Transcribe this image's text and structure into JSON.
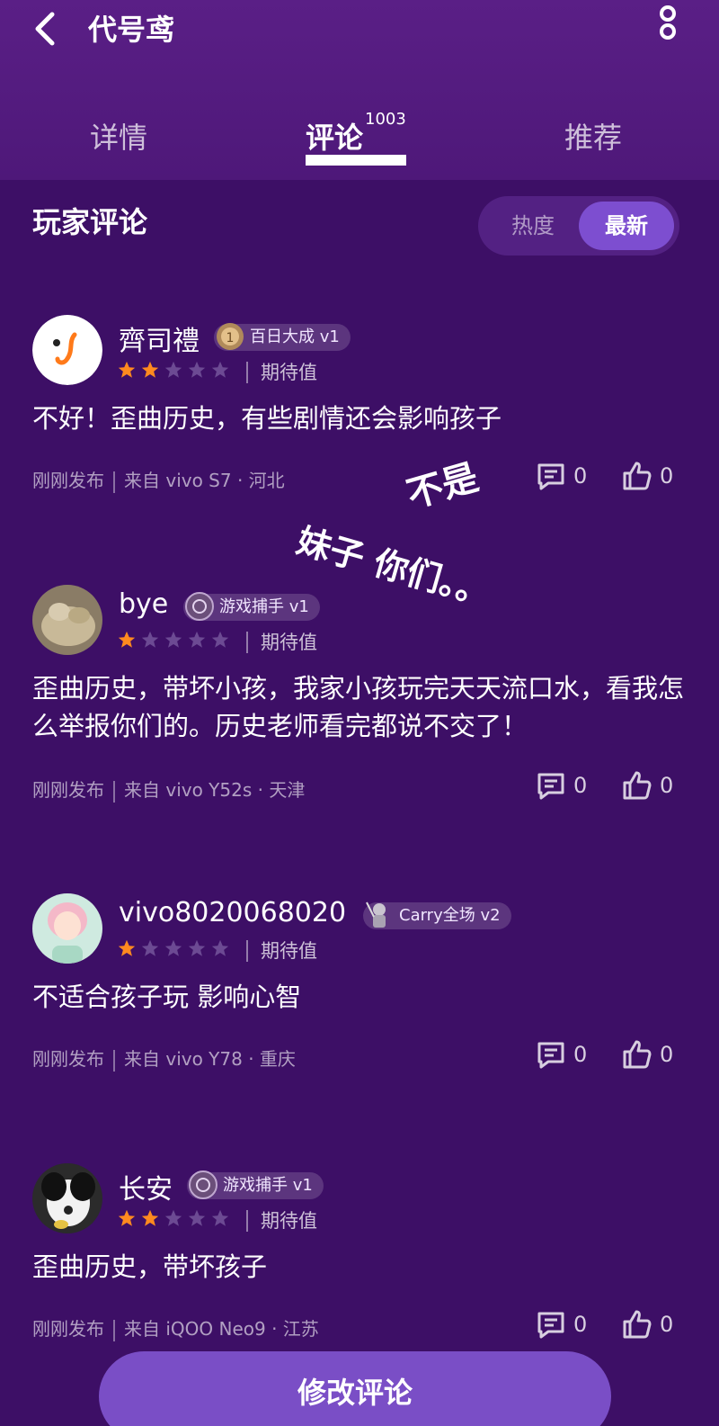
{
  "header": {
    "title": "代号鸢",
    "tabs": [
      {
        "label": "详情"
      },
      {
        "label": "评论",
        "count": "1003"
      },
      {
        "label": "推荐"
      }
    ]
  },
  "section": {
    "title": "玩家评论",
    "sort_options": [
      "热度",
      "最新"
    ],
    "selected_sort": "最新"
  },
  "reviews": [
    {
      "username": "齊司禮",
      "badge": "百日大成 v1",
      "rating": 2,
      "rating_label": "期待值",
      "text": "不好！歪曲历史，有些剧情还会影响孩子",
      "time": "刚刚发布",
      "device": "来自 vivo S7 · 河北",
      "comments": "0",
      "likes": "0"
    },
    {
      "username": "bye",
      "badge": "游戏捕手 v1",
      "rating": 1,
      "rating_label": "期待值",
      "text": "歪曲历史，带坏小孩，我家小孩玩完天天流口水，看我怎么举报你们的。历史老师看完都说不交了！",
      "time": "刚刚发布",
      "device": "来自 vivo Y52s · 天津",
      "comments": "0",
      "likes": "0"
    },
    {
      "username": "vivo8020068020",
      "badge": "Carry全场 v2",
      "rating": 1,
      "rating_label": "期待值",
      "text": "不适合孩子玩 影响心智",
      "time": "刚刚发布",
      "device": "来自 vivo Y78 · 重庆",
      "comments": "0",
      "likes": "0"
    },
    {
      "username": "长安",
      "badge": "游戏捕手 v1",
      "rating": 2,
      "rating_label": "期待值",
      "text": "歪曲历史，带坏孩子",
      "time": "刚刚发布",
      "device": "来自 iQOO Neo9 · 江苏",
      "comments": "0",
      "likes": "0"
    }
  ],
  "annotation": {
    "line1": "不是",
    "line2": "妹子 你们。。"
  },
  "footer": {
    "edit_button": "修改评论"
  },
  "colors": {
    "background": "#3d0f66",
    "header": "#541c80",
    "accent": "#7d4ed0",
    "star_active": "#ff8a1f",
    "star_inactive": "#6c4a93"
  }
}
